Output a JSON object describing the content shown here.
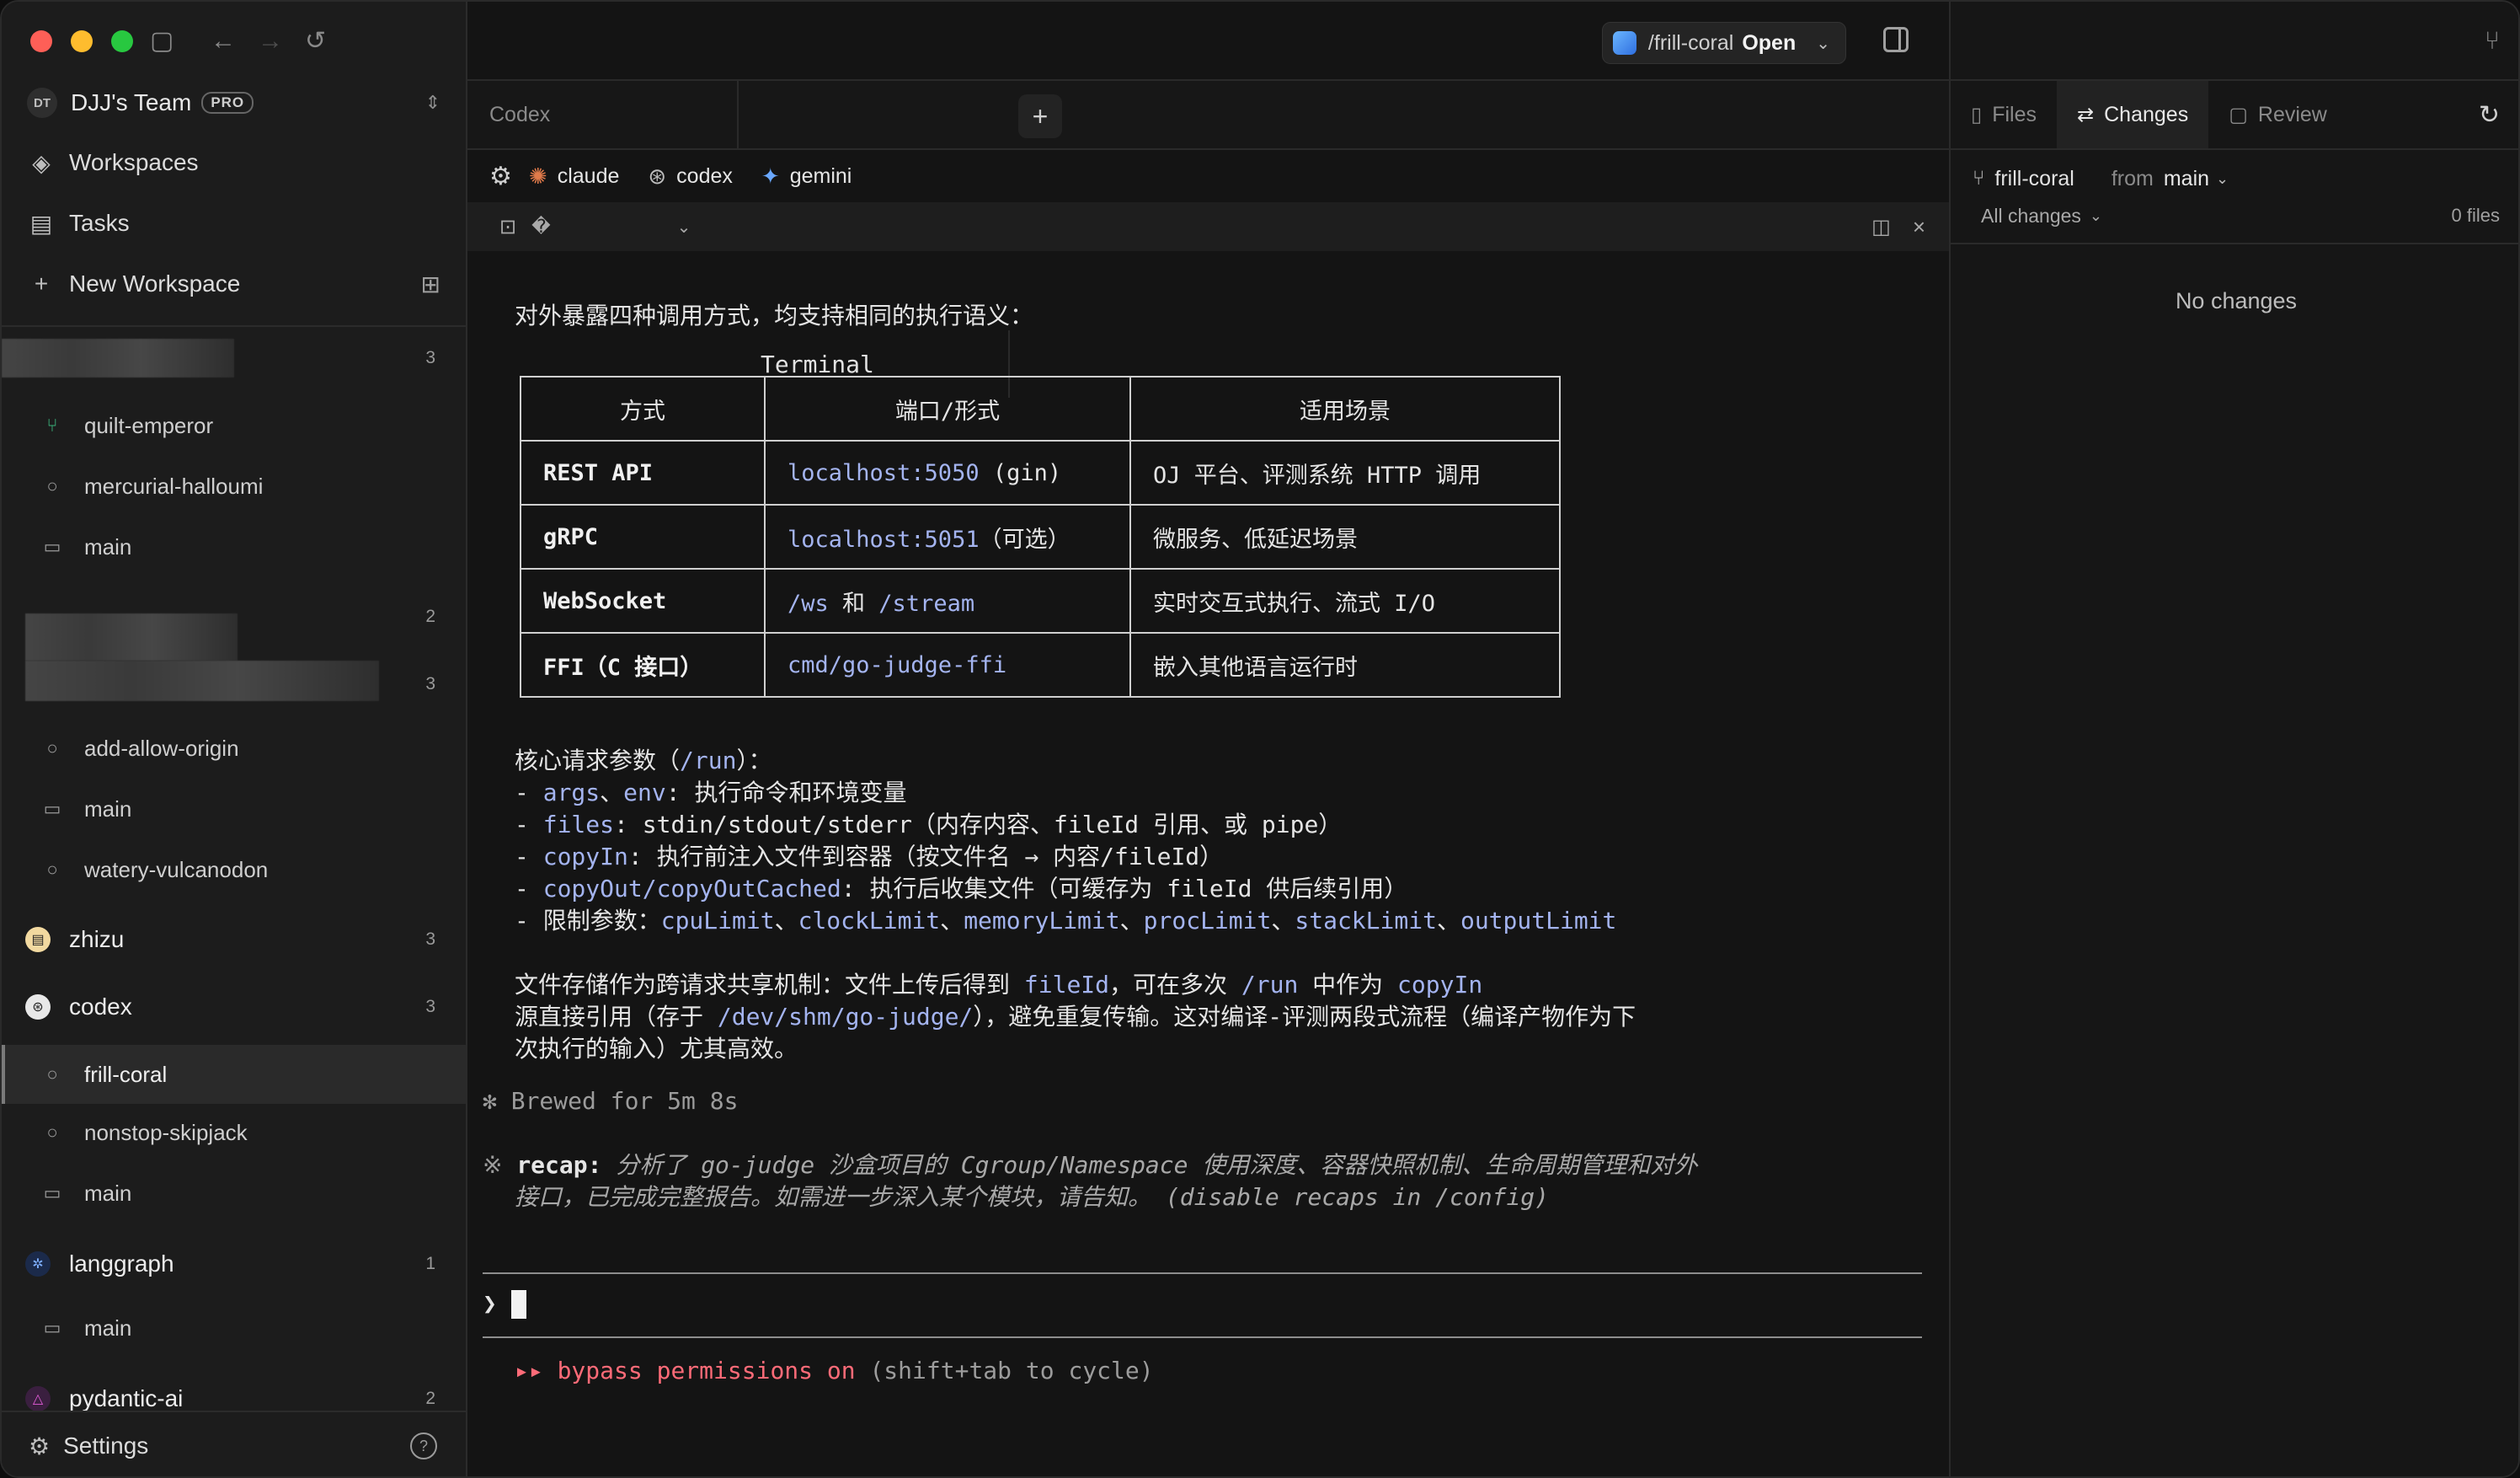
{
  "sidebar": {
    "team": {
      "initials": "DT",
      "name": "DJJ's Team",
      "badge": "PRO"
    },
    "nav": [
      {
        "label": "Workspaces",
        "icon": "layers-icon"
      },
      {
        "label": "Tasks",
        "icon": "clipboard-icon"
      },
      {
        "label": "New Workspace",
        "icon": "plus-icon"
      }
    ],
    "workspaces": {
      "group1_count": "3",
      "quilt_emperor": "quilt-emperor",
      "mercurial_halloumi": "mercurial-halloumi",
      "main1": "main",
      "group2_count": "2",
      "group3_count": "3",
      "add_allow_origin": "add-allow-origin",
      "main2": "main",
      "watery_vulcanodon": "watery-vulcanodon",
      "zhizu": {
        "label": "zhizu",
        "count": "3"
      },
      "codex": {
        "label": "codex",
        "count": "3"
      },
      "frill_coral": "frill-coral",
      "nonstop_skipjack": "nonstop-skipjack",
      "main3": "main",
      "langgraph": {
        "label": "langgraph",
        "count": "1"
      },
      "main4": "main",
      "pydantic_ai": {
        "label": "pydantic-ai",
        "count": "2"
      }
    },
    "settings_label": "Settings",
    "help_label": "?"
  },
  "topbar": {
    "path": "/frill-coral",
    "open_label": "Open"
  },
  "tabs": {
    "codex": "Codex",
    "terminal": "Terminal",
    "add": "+"
  },
  "agents": [
    {
      "label": "claude"
    },
    {
      "label": "codex"
    },
    {
      "label": "gemini"
    }
  ],
  "terminal": {
    "head_glyph": "�",
    "intro": "对外暴露四种调用方式，均支持相同的执行语义：",
    "table": {
      "headers": [
        "方式",
        "端口/形式",
        "适用场景"
      ],
      "rows": [
        {
          "name": "REST API",
          "port_hl": "localhost:5050",
          "port_rest": " (gin)",
          "use": "OJ 平台、评测系统 HTTP 调用"
        },
        {
          "name": "gRPC",
          "port_hl": "localhost:5051",
          "port_rest": "（可选）",
          "use": "微服务、低延迟场景"
        },
        {
          "name": "WebSocket",
          "port_hl": "/ws",
          "port_mid": " 和 ",
          "port_hl2": "/stream",
          "use": "实时交互式执行、流式 I/O"
        },
        {
          "name": "FFI（C 接口）",
          "port_hl": "cmd/go-judge-ffi",
          "port_rest": "",
          "use": "嵌入其他语言运行时"
        }
      ]
    },
    "params": {
      "title_a": "核心请求参数（",
      "title_hl": "/run",
      "title_b": "）：",
      "l1_a": "- ",
      "l1_h1": "args",
      "l1_b": "、",
      "l1_h2": "env",
      "l1_c": ": 执行命令和环境变量",
      "l2_a": "- ",
      "l2_h": "files",
      "l2_b": ": stdin/stdout/stderr（内存内容、fileId 引用、或 pipe）",
      "l3_a": "- ",
      "l3_h": "copyIn",
      "l3_b": ": 执行前注入文件到容器（按文件名 → 内容/fileId）",
      "l4_a": "- ",
      "l4_h": "copyOut/copyOutCached",
      "l4_b": ": 执行后收集文件（可缓存为 fileId 供后续引用）",
      "l5_a": "- 限制参数：",
      "l5_h1": "cpuLimit",
      "l5_s1": "、",
      "l5_h2": "clockLimit",
      "l5_s2": "、",
      "l5_h3": "memoryLimit",
      "l5_s3": "、",
      "l5_h4": "procLimit",
      "l5_s4": "、",
      "l5_h5": "stackLimit",
      "l5_s5": "、",
      "l5_h6": "outputLimit"
    },
    "storage": {
      "l1_a": "文件存储作为跨请求共享机制：文件上传后得到 ",
      "l1_h1": "fileId",
      "l1_b": "，可在多次 ",
      "l1_h2": "/run",
      "l1_c": " 中作为 ",
      "l1_h3": "copyIn",
      "l2_a": "源直接引用（存于 ",
      "l2_h": "/dev/shm/go-judge/",
      "l2_b": "），避免重复传输。这对编译-评测两段式流程（编译产物作为下",
      "l3": "次执行的输入）尤其高效。"
    },
    "brewed": "✻ Brewed for 5m 8s",
    "recap": {
      "mark": "※ ",
      "label": "recap:",
      "l1": " 分析了 go-judge 沙盒项目的 Cgroup/Namespace 使用深度、容器快照机制、生命周期管理和对外",
      "l2": "接口，已完成完整报告。如需进一步深入某个模块，请告知。",
      "l2_hint": " (disable recaps in /config)"
    },
    "prompt": "❯",
    "bypass": {
      "arrows": "▸▸ ",
      "label": "bypass permissions on",
      "hint": " (shift+tab to cycle)"
    }
  },
  "rpanel": {
    "tabs": [
      {
        "label": "Files"
      },
      {
        "label": "Changes"
      },
      {
        "label": "Review"
      }
    ],
    "branch": "frill-coral",
    "from": "from",
    "base": "main",
    "filter": "All changes",
    "file_count": "0 files",
    "empty": "No changes"
  }
}
